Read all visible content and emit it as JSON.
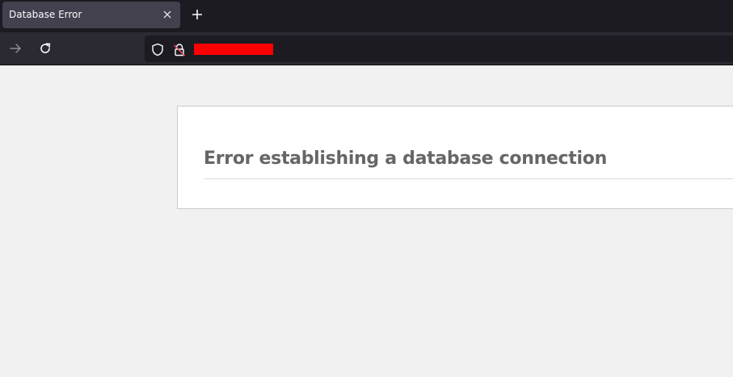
{
  "browser": {
    "tab": {
      "title": "Database Error",
      "close_icon": "close-icon"
    },
    "new_tab_icon": "plus-icon",
    "nav": {
      "forward_icon": "arrow-right-icon",
      "reload_icon": "reload-icon"
    },
    "urlbar": {
      "shield_icon": "shield-icon",
      "lock_icon": "insecure-lock-icon",
      "url": "",
      "redaction_color": "#ff0000"
    }
  },
  "page": {
    "heading": "Error establishing a database connection"
  },
  "colors": {
    "tabbar_bg": "#1c1b22",
    "active_tab_bg": "#42414d",
    "navbar_bg": "#2b2a33",
    "page_bg": "#f1f1f1",
    "heading_color": "#666666"
  }
}
